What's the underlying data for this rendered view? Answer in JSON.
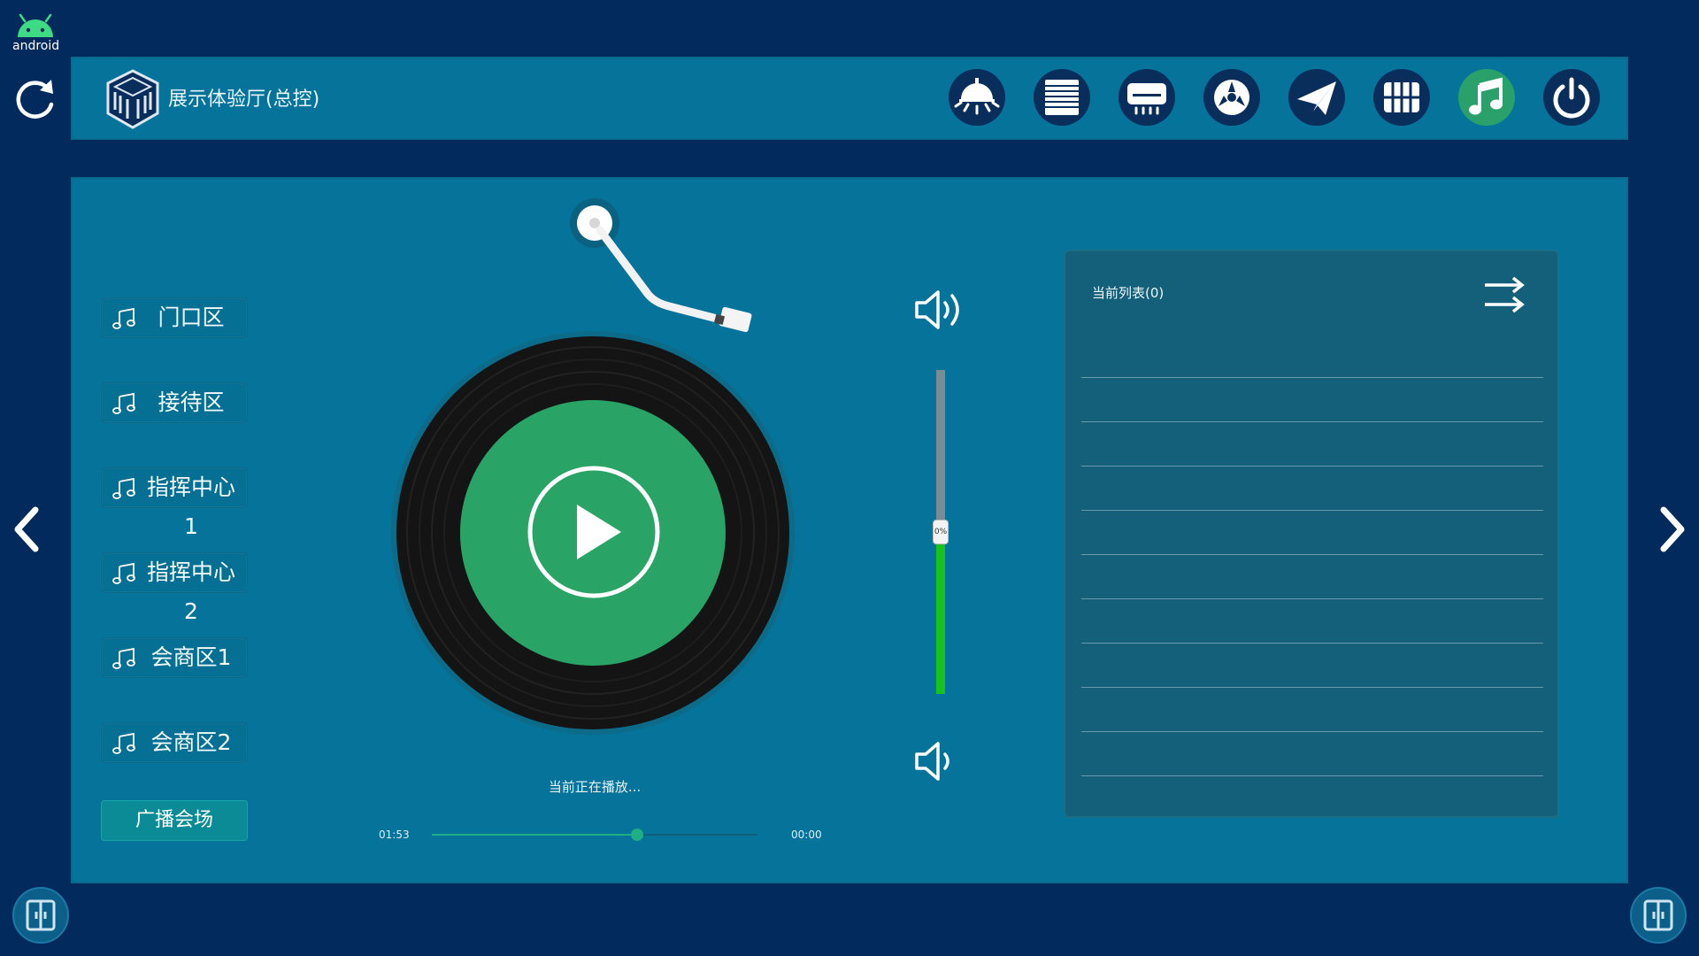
{
  "system": {
    "android_label": "android"
  },
  "header": {
    "title": "展示体验厅(总控)",
    "icons": [
      {
        "name": "light-icon",
        "active": false
      },
      {
        "name": "curtain-icon",
        "active": false
      },
      {
        "name": "air-conditioner-icon",
        "active": false
      },
      {
        "name": "fan-icon",
        "active": false
      },
      {
        "name": "send-icon",
        "active": false
      },
      {
        "name": "scene-grid-icon",
        "active": false
      },
      {
        "name": "music-icon",
        "active": true
      },
      {
        "name": "power-icon",
        "active": false
      }
    ]
  },
  "zones": [
    {
      "label": "门口区"
    },
    {
      "label": "接待区"
    },
    {
      "label": "指挥中心1"
    },
    {
      "label": "指挥中心2"
    },
    {
      "label": "会商区1"
    },
    {
      "label": "会商区2"
    }
  ],
  "broadcast_label": "广播会场",
  "player": {
    "status": "当前正在播放...",
    "time_start": "01:53",
    "time_end": "00:00",
    "progress_fraction": 0.63
  },
  "volume": {
    "label": "0%",
    "fraction": 0.5
  },
  "playlist": {
    "title": "当前列表(0)",
    "rows": 10
  },
  "colors": {
    "background": "#032a5c",
    "panel": "#05739a",
    "accent_green": "#2aa06a",
    "volume_green": "#19c21a"
  }
}
